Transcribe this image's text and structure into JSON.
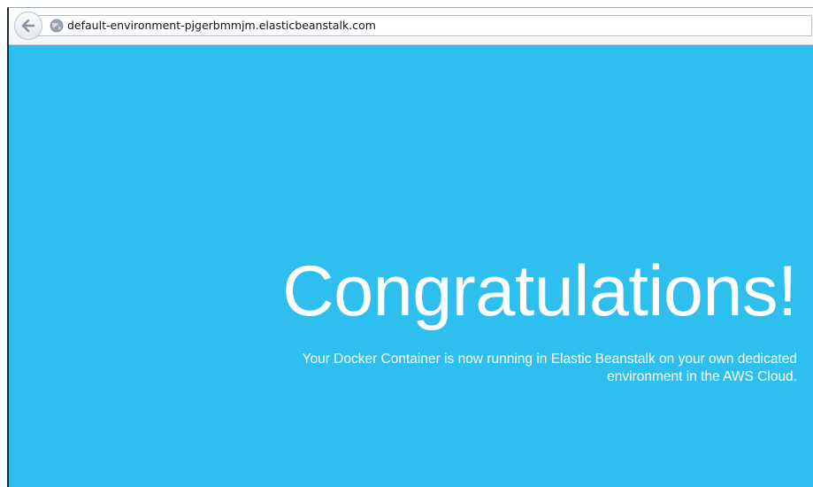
{
  "browser": {
    "address": "default-environment-pjgerbmmjm.elasticbeanstalk.com",
    "back_icon": "back-arrow-icon",
    "site_icon": "globe-icon"
  },
  "page": {
    "headline": "Congratulations!",
    "message": "Your Docker Container is now running in Elastic Beanstalk on your own dedicated environment in the AWS Cloud.",
    "background_color": "#2fbfee",
    "text_color": "#ffffff"
  }
}
